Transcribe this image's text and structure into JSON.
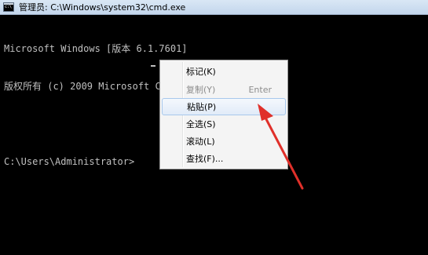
{
  "window": {
    "title": "管理员: C:\\Windows\\system32\\cmd.exe",
    "icon": "cmd-icon"
  },
  "console": {
    "lines": [
      "Microsoft Windows [版本 6.1.7601]",
      "版权所有 (c) 2009 Microsoft Corporation。保留所有权利。",
      "",
      "C:\\Users\\Administrator>"
    ]
  },
  "context_menu": {
    "items": [
      {
        "label": "标记(K)",
        "shortcut": "",
        "enabled": true,
        "highlighted": false
      },
      {
        "label": "复制(Y)",
        "shortcut": "Enter",
        "enabled": false,
        "highlighted": false
      },
      {
        "label": "粘贴(P)",
        "shortcut": "",
        "enabled": true,
        "highlighted": true
      },
      {
        "label": "全选(S)",
        "shortcut": "",
        "enabled": true,
        "highlighted": false
      },
      {
        "label": "滚动(L)",
        "shortcut": "",
        "enabled": true,
        "highlighted": false
      },
      {
        "label": "查找(F)...",
        "shortcut": "",
        "enabled": true,
        "highlighted": false
      }
    ]
  },
  "annotation": {
    "type": "arrow",
    "color": "#e0302a",
    "points_to": "paste-menu-item"
  },
  "colors": {
    "console_bg": "#000000",
    "console_fg": "#c0c0c0",
    "menu_bg": "#f4f4f4",
    "highlight_border": "#a8c8ec"
  }
}
